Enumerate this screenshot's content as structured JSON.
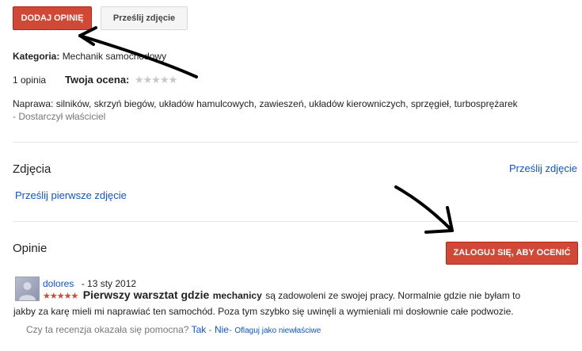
{
  "toolbar": {
    "add_review_label": "DODAJ OPINIĘ",
    "upload_photo_label": "Prześlij zdjęcie"
  },
  "category": {
    "label": "Kategoria:",
    "value": "Mechanik samochodowy"
  },
  "summary": {
    "reviews_count": "1 opinia",
    "your_rating_label": "Twoja ocena:",
    "your_rating_stars": "★★★★★"
  },
  "repairs": {
    "text": "Naprawa: silników, skrzyń biegów, układów hamulcowych, zawieszeń, układów kierowniczych, sprzęgieł, turbosprężarek",
    "source": "- Dostarczył właściciel"
  },
  "photos": {
    "heading": "Zdjęcia",
    "upload_link": "Prześlij zdjęcie",
    "first_photo_link": "Prześlij pierwsze zdjęcie"
  },
  "reviews": {
    "heading": "Opinie",
    "login_button_label": "ZALOGUJ SIĘ, ABY OCENIĆ",
    "items": [
      {
        "author": "dolores",
        "date": "- 13 sty 2012",
        "stars": "★★★★★",
        "title": "Pierwszy warsztat gdzie",
        "body_lead": "mechanicy",
        "body_line1": "są zadowoleni ze swojej pracy. Normalnie gdzie nie byłam to",
        "body_line2": "jakby za karę mieli mi naprawiać ten samochód. Poza tym szybko się uwinęli a wymieniali mi dosłownie całe podwozie.",
        "helpful_question": "Czy ta recenzja okazała się pomocna?",
        "yes": "Tak",
        "no": "Nie",
        "flag": "Oflaguj jako niewłaściwe"
      }
    ]
  },
  "colors": {
    "accent_red": "#d14836",
    "link_blue": "#1155cc"
  }
}
